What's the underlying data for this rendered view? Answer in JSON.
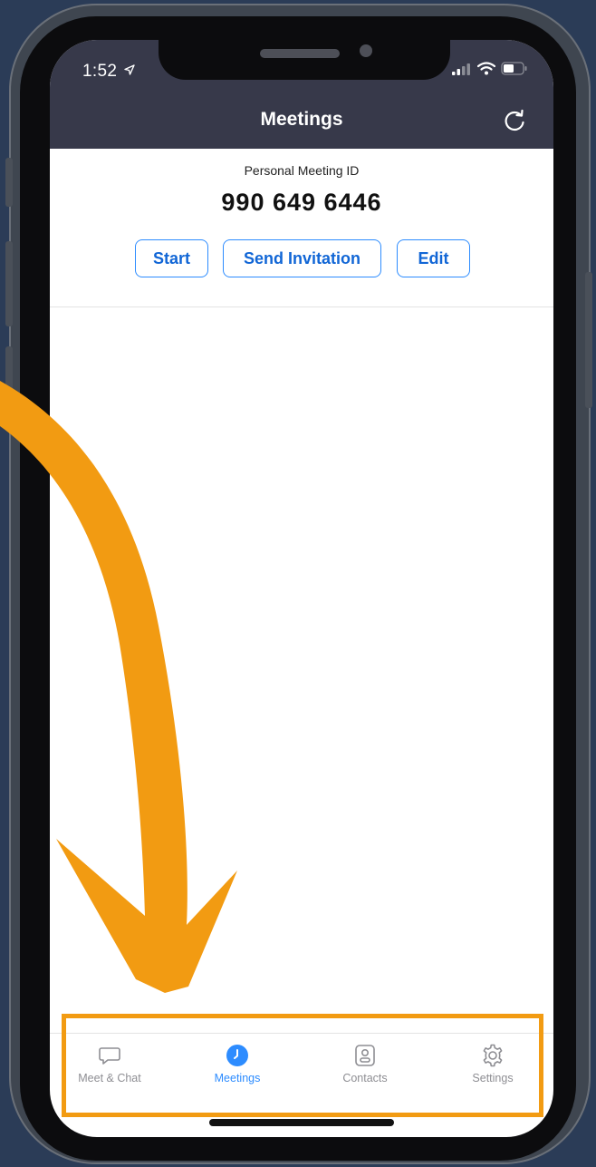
{
  "status_bar": {
    "time": "1:52"
  },
  "header": {
    "title": "Meetings",
    "refresh_icon": "refresh-icon"
  },
  "personal_meeting": {
    "label": "Personal Meeting ID",
    "id": "990 649 6446"
  },
  "actions": {
    "start": "Start",
    "send_invitation": "Send Invitation",
    "edit": "Edit"
  },
  "tab_bar": {
    "tabs": [
      {
        "label": "Meet & Chat",
        "icon": "chat-bubble-icon",
        "active": false
      },
      {
        "label": "Meetings",
        "icon": "clock-icon",
        "active": true
      },
      {
        "label": "Contacts",
        "icon": "contacts-icon",
        "active": false
      },
      {
        "label": "Settings",
        "icon": "gear-icon",
        "active": false
      }
    ]
  },
  "colors": {
    "header_bg": "#37394a",
    "accent": "#2d8cff",
    "annotation_orange": "#f29b12",
    "background": "#2b3c57"
  }
}
